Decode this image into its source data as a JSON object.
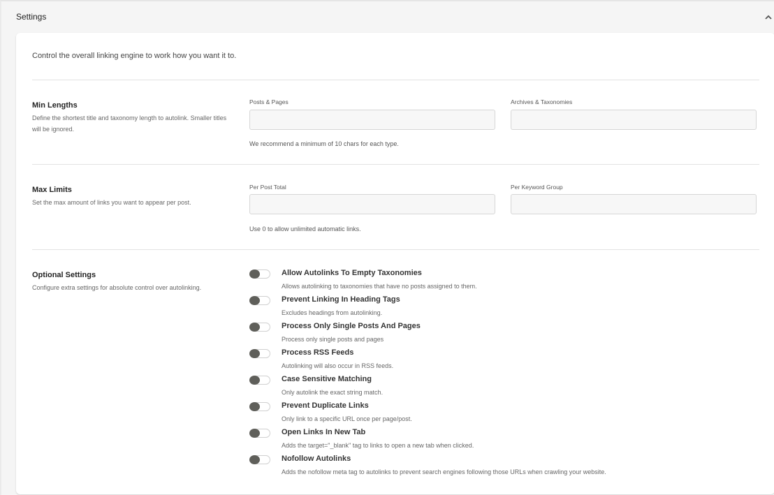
{
  "header": {
    "title": "Settings",
    "collapse_icon": "chevron-up-icon"
  },
  "intro": "Control the overall linking engine to work how you want it to.",
  "min_lengths": {
    "title": "Min Lengths",
    "description": "Define the shortest title and taxonomy length to autolink. Smaller titles will be ignored.",
    "fields": [
      {
        "label": "Posts & Pages",
        "value": "",
        "placeholder": ""
      },
      {
        "label": "Archives & Taxonomies",
        "value": "",
        "placeholder": ""
      }
    ],
    "help": "We recommend a minimum of 10 chars for each type."
  },
  "max_limits": {
    "title": "Max Limits",
    "description": "Set the max amount of links you want to appear per post.",
    "fields": [
      {
        "label": "Per Post Total",
        "value": "",
        "placeholder": ""
      },
      {
        "label": "Per Keyword Group",
        "value": "",
        "placeholder": ""
      }
    ],
    "help": "Use 0 to allow unlimited automatic links."
  },
  "optional_settings": {
    "title": "Optional Settings",
    "description": "Configure extra settings for absolute control over autolinking.",
    "toggles": [
      {
        "label": "Allow Autolinks To Empty Taxonomies",
        "description": "Allows autolinking to taxonomies that have no posts assigned to them.",
        "enabled": false
      },
      {
        "label": "Prevent Linking In Heading Tags",
        "description": "Excludes headings from autolinking.",
        "enabled": false
      },
      {
        "label": "Process Only Single Posts And Pages",
        "description": "Process only single posts and pages",
        "enabled": false
      },
      {
        "label": "Process RSS Feeds",
        "description": "Autolinking will also occur in RSS feeds.",
        "enabled": false
      },
      {
        "label": "Case Sensitive Matching",
        "description": "Only autolink the exact string match.",
        "enabled": false
      },
      {
        "label": "Prevent Duplicate Links",
        "description": "Only link to a specific URL once per page/post.",
        "enabled": false
      },
      {
        "label": "Open Links In New Tab",
        "description": "Adds the target=\"_blank\" tag to links to open a new tab when clicked.",
        "enabled": false
      },
      {
        "label": "Nofollow Autolinks",
        "description": "Adds the nofollow meta tag to autolinks to prevent search engines following those URLs when crawling your website.",
        "enabled": false
      }
    ]
  },
  "colors": {
    "page_bg": "#f5f5f5",
    "card_bg": "#ffffff",
    "toggle_knob": "#5f5f5a",
    "input_bg": "#f7f7f7",
    "input_border": "#d6d6d6"
  }
}
